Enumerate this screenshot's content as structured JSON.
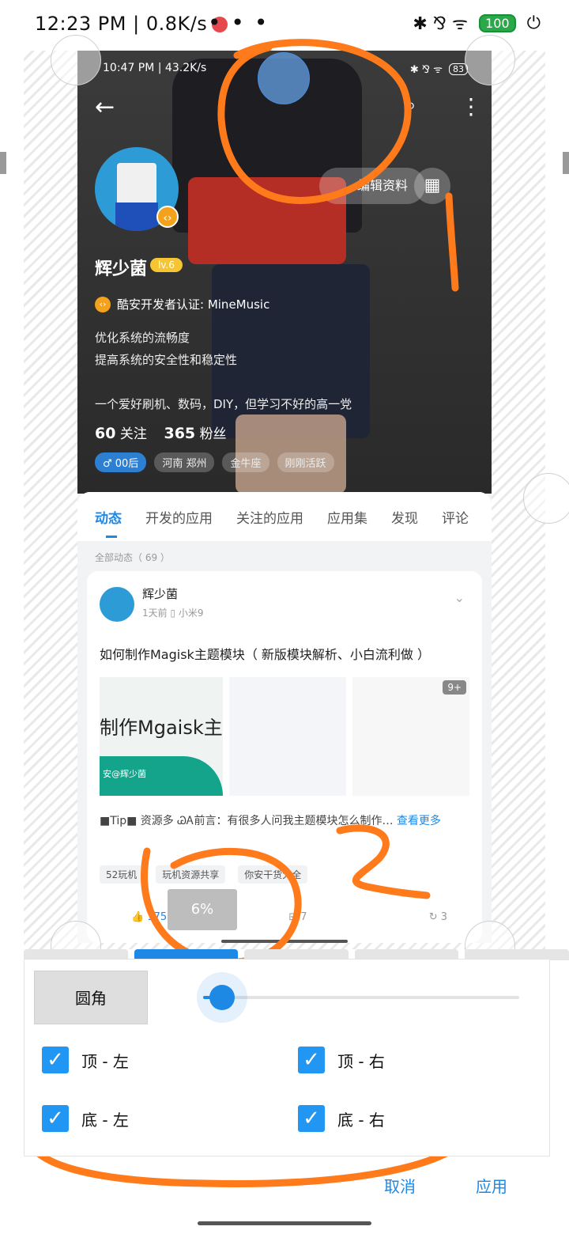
{
  "outer_status": {
    "time_speed": "12:23 PM | 0.8K/s",
    "dots": "• • •",
    "right_icons": "✱  ⅋  ᯤ",
    "battery": "100"
  },
  "inner": {
    "status_left": "10:47 PM | 43.2K/s",
    "status_right": "✱ ⅋ ᯤ",
    "battery": "83",
    "edit_profile": "编辑资料",
    "username": "辉少菌",
    "level": "lv.6",
    "cert": "酷安开发者认证: MineMusic",
    "bio1": "优化系统的流畅度",
    "bio2": "提高系统的安全性和稳定性",
    "bio3": "一个爱好刷机、数码，DIY，但学习不好的高一党",
    "stats": {
      "following_num": "60",
      "following_label": "关注",
      "fans_num": "365",
      "fans_label": "粉丝"
    },
    "tags": [
      "♂ 00后",
      "河南 郑州",
      "金牛座",
      "刚刚活跃"
    ],
    "tabs": [
      "动态",
      "开发的应用",
      "关注的应用",
      "应用集",
      "发现",
      "评论"
    ],
    "section_header": "全部动态（ 69 ）",
    "post": {
      "author": "辉少菌",
      "meta": "1天前   ▯ 小米9",
      "title": "如何制作Magisk主题模块（ 新版模块解析、小白流利做 ）",
      "img_big_text": "制作Mgaisk主题",
      "img_by": "安@辉少菌",
      "img_more": "9+",
      "body": "■Tip■ 资源多 ᏊᎪ前言：有很多人问我主题模块怎么制作…",
      "read_more": "查看更多",
      "chips": [
        "52玩机",
        "玩机资源共享",
        "你安干货大全"
      ],
      "likes": "175",
      "comments": "7",
      "shares": "3"
    }
  },
  "toast": "6%",
  "dialog": {
    "round_label": "圆角",
    "slider_value": 0.06,
    "checks": {
      "top_left": "顶 - 左",
      "top_right": "顶 - 右",
      "bottom_left": "底 - 左",
      "bottom_right": "底 - 右"
    },
    "cancel": "取消",
    "apply": "应用"
  },
  "accent": "#1e88e5",
  "annotation_color": "#ff7a1a"
}
